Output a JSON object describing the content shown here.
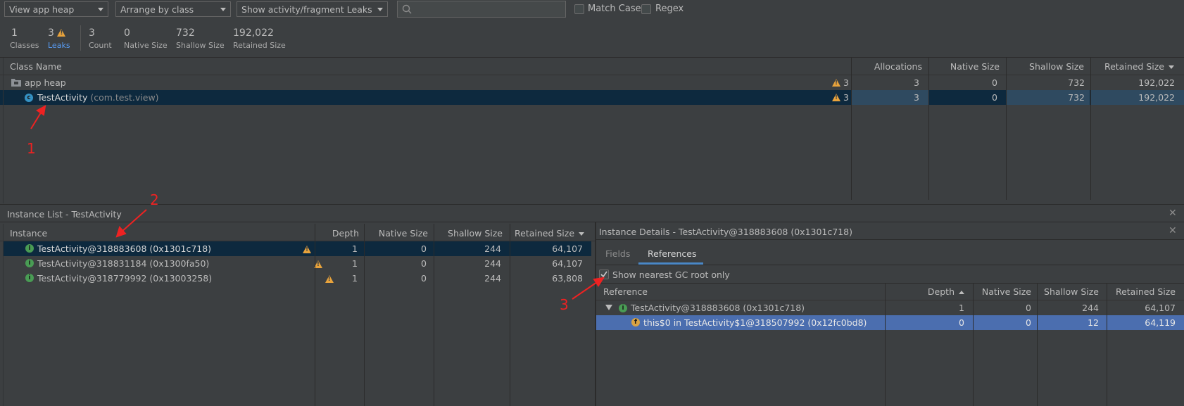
{
  "toolbar": {
    "heap_select": "View app heap",
    "arrange_select": "Arrange by class",
    "filter_select": "Show activity/fragment Leaks",
    "search_placeholder": "",
    "match_case": "Match Case",
    "regex": "Regex"
  },
  "stats": [
    {
      "value": "1",
      "label": "Classes"
    },
    {
      "value": "3",
      "label": "Leaks"
    },
    {
      "value": "3",
      "label": "Count"
    },
    {
      "value": "0",
      "label": "Native Size"
    },
    {
      "value": "732",
      "label": "Shallow Size"
    },
    {
      "value": "192,022",
      "label": "Retained Size"
    }
  ],
  "class_table": {
    "headers": {
      "name": "Class Name",
      "allocations": "Allocations",
      "native": "Native Size",
      "shallow": "Shallow Size",
      "retained": "Retained Size"
    },
    "rows": [
      {
        "name": "app heap",
        "pkg": "",
        "leaks": "3",
        "allocations": "3",
        "native": "0",
        "shallow": "732",
        "retained": "192,022"
      },
      {
        "name": "TestActivity",
        "pkg": "(com.test.view)",
        "leaks": "3",
        "allocations": "3",
        "native": "0",
        "shallow": "732",
        "retained": "192,022"
      }
    ]
  },
  "instance_list": {
    "title": "Instance List - TestActivity",
    "headers": {
      "instance": "Instance",
      "depth": "Depth",
      "native": "Native Size",
      "shallow": "Shallow Size",
      "retained": "Retained Size"
    },
    "rows": [
      {
        "name": "TestActivity@318883608 (0x1301c718)",
        "depth": "1",
        "native": "0",
        "shallow": "244",
        "retained": "64,107"
      },
      {
        "name": "TestActivity@318831184 (0x1300fa50)",
        "depth": "1",
        "native": "0",
        "shallow": "244",
        "retained": "64,107"
      },
      {
        "name": "TestActivity@318779992 (0x13003258)",
        "depth": "1",
        "native": "0",
        "shallow": "244",
        "retained": "63,808"
      }
    ]
  },
  "instance_details": {
    "title": "Instance Details - TestActivity@318883608 (0x1301c718)",
    "tabs": [
      "Fields",
      "References"
    ],
    "gc_root_label": "Show nearest GC root only",
    "headers": {
      "reference": "Reference",
      "depth": "Depth",
      "native": "Native Size",
      "shallow": "Shallow Size",
      "retained": "Retained Size"
    },
    "rows": [
      {
        "name": "TestActivity@318883608 (0x1301c718)",
        "depth": "1",
        "native": "0",
        "shallow": "244",
        "retained": "64,107"
      },
      {
        "name": "this$0 in TestActivity$1@318507992 (0x12fc0bd8)",
        "depth": "0",
        "native": "0",
        "shallow": "12",
        "retained": "64,119"
      }
    ]
  },
  "annotations": [
    "1",
    "2",
    "3"
  ],
  "colors": {
    "accent": "#589df6",
    "warning": "#e8a33c",
    "selected_row": "#0d293e",
    "selected_detail_row": "#4b6eaf",
    "annotation": "#ee2222"
  }
}
